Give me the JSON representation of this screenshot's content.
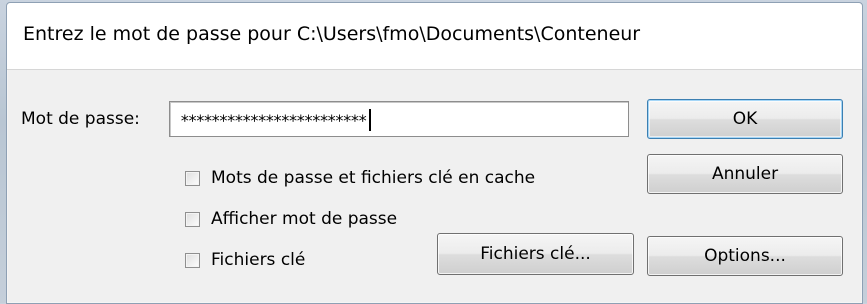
{
  "dialog": {
    "title": "Entrez le mot de passe pour C:\\Users\\fmo\\Documents\\Conteneur"
  },
  "password": {
    "label": "Mot de passe:",
    "value": "************************"
  },
  "checkboxes": {
    "cache": {
      "label": "Mots de passe et fichiers clé en cache",
      "checked": false
    },
    "show_password": {
      "label": "Afficher mot de passe",
      "checked": false
    },
    "keyfiles": {
      "label": "Fichiers clé",
      "checked": false
    }
  },
  "buttons": {
    "ok": "OK",
    "cancel": "Annuler",
    "keyfiles": "Fichiers clé...",
    "options": "Options..."
  }
}
